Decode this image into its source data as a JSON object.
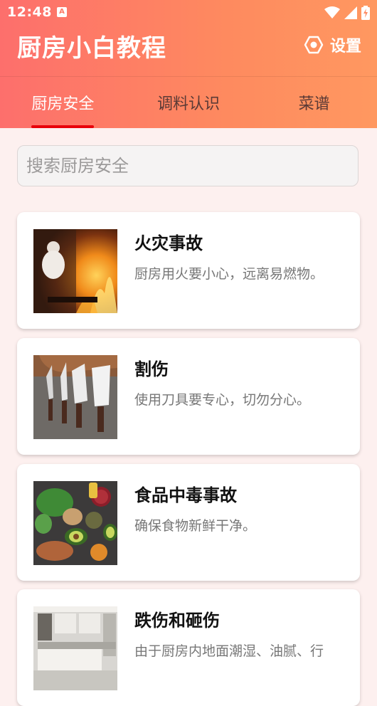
{
  "status_bar": {
    "time": "12:48",
    "notification_icon": "a-letter-icon",
    "icons": [
      "wifi-icon",
      "signal-icon",
      "battery-charging-icon"
    ]
  },
  "appbar": {
    "title": "厨房小白教程",
    "settings_label": "设置",
    "settings_icon": "gear-icon"
  },
  "tabs": [
    {
      "label": "厨房安全",
      "active": true
    },
    {
      "label": "调料认识",
      "active": false
    },
    {
      "label": "菜谱",
      "active": false
    }
  ],
  "search": {
    "placeholder": "搜索厨房安全",
    "value": ""
  },
  "cards": [
    {
      "title": "火灾事故",
      "desc": "厨房用火要小心，远离易燃物。",
      "image": "chef-fire-photo"
    },
    {
      "title": "割伤",
      "desc": "使用刀具要专心，切勿分心。",
      "image": "knives-photo"
    },
    {
      "title": "食品中毒事故",
      "desc": "确保食物新鲜干净。",
      "image": "fresh-food-photo"
    },
    {
      "title": "跌伤和砸伤",
      "desc": "由于厨房内地面潮湿、油腻、行",
      "image": "kitchen-interior-photo"
    }
  ],
  "colors": {
    "header_start": "#fd6f6c",
    "header_end": "#ff9860",
    "tab_indicator": "#e8000a",
    "background": "#fdf0ef"
  }
}
